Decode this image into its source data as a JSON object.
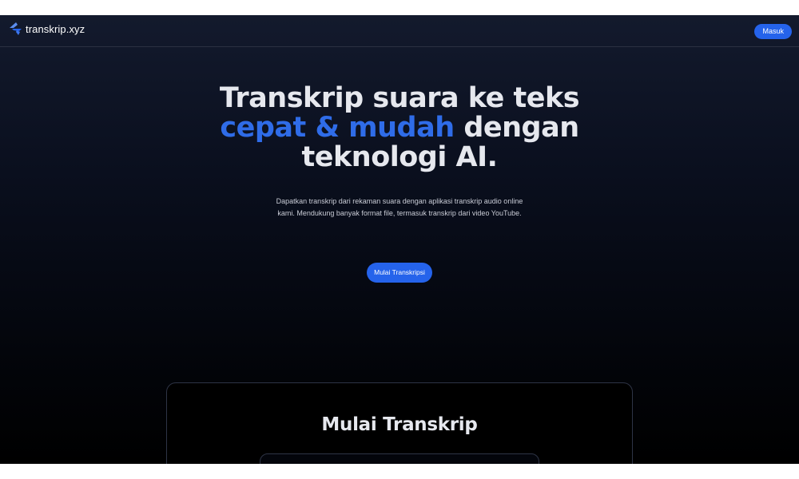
{
  "navbar": {
    "brand": "transkrip.xyz",
    "brand_icon": "transkrip-logo-icon",
    "login_label": "Masuk"
  },
  "hero": {
    "title_line1": "Transkrip suara ke teks",
    "title_accent": "cepat & mudah",
    "title_line2_rest": " dengan",
    "title_line3": "teknologi AI.",
    "description": "Dapatkan transkrip dari rekaman suara dengan aplikasi transkrip audio online kami. Mendukung banyak format file, termasuk transkrip dari video YouTube.",
    "cta_label": "Mulai Transkripsi"
  },
  "transcribe_card": {
    "title": "Mulai Transkrip"
  },
  "colors": {
    "accent": "#2563eb",
    "background_top": "#131a2d",
    "background_bottom": "#000000",
    "text": "#e6e8ee"
  }
}
